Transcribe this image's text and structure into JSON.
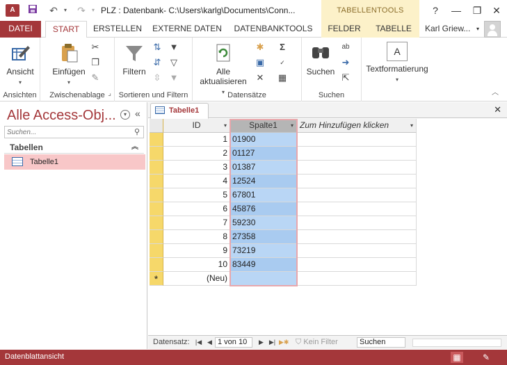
{
  "titlebar": {
    "app_icon_label": "A",
    "title": "PLZ : Datenbank- C:\\Users\\karlg\\Documents\\Conn...",
    "context_label": "TABELLENTOOLS",
    "help": "?",
    "minimize": "—",
    "restore": "❐",
    "close": "✕"
  },
  "tabs": {
    "file": "DATEI",
    "items": [
      "START",
      "ERSTELLEN",
      "EXTERNE DATEN",
      "DATENBANKTOOLS",
      "FELDER",
      "TABELLE"
    ],
    "active_index": 0,
    "user": "Karl Griew..."
  },
  "ribbon": {
    "groups": {
      "ansichten": {
        "label": "Ansichten",
        "view": "Ansicht"
      },
      "zwischenablage": {
        "label": "Zwischenablage",
        "paste": "Einfügen"
      },
      "sortieren": {
        "label": "Sortieren und Filtern",
        "filter": "Filtern"
      },
      "datensaetze": {
        "label": "Datensätze",
        "refresh_line1": "Alle",
        "refresh_line2": "aktualisieren"
      },
      "suchen": {
        "label": "Suchen",
        "find": "Suchen"
      },
      "textformat": {
        "label": "Textformatierung",
        "icon_letter": "A"
      }
    }
  },
  "nav_pane": {
    "title": "Alle Access-Obj...",
    "search_placeholder": "Suchen...",
    "group_header": "Tabellen",
    "items": [
      {
        "label": "Tabelle1"
      }
    ]
  },
  "document": {
    "tab_label": "Tabelle1",
    "close": "✕"
  },
  "datasheet": {
    "columns": [
      "ID",
      "Spalte1",
      "Zum Hinzufügen klicken"
    ],
    "rows": [
      {
        "id": "1",
        "value": "01900"
      },
      {
        "id": "2",
        "value": "01127"
      },
      {
        "id": "3",
        "value": "01387"
      },
      {
        "id": "4",
        "value": "12524"
      },
      {
        "id": "5",
        "value": "67801"
      },
      {
        "id": "6",
        "value": "45876"
      },
      {
        "id": "7",
        "value": "59230"
      },
      {
        "id": "8",
        "value": "27358"
      },
      {
        "id": "9",
        "value": "73219"
      },
      {
        "id": "10",
        "value": "83449"
      }
    ],
    "new_row_marker": "*",
    "new_row_label": "(Neu)"
  },
  "record_nav": {
    "label": "Datensatz:",
    "record_count": "1 von 10",
    "filter": "Kein Filter",
    "search": "Suchen"
  },
  "statusbar": {
    "text": "Datenblattansicht"
  },
  "colors": {
    "accent": "#a4373a",
    "context_band": "#fcf1c9",
    "selected_column": "#b9d6f5",
    "nav_selected": "#f8c7c8",
    "row_selector": "#f6d86a"
  }
}
